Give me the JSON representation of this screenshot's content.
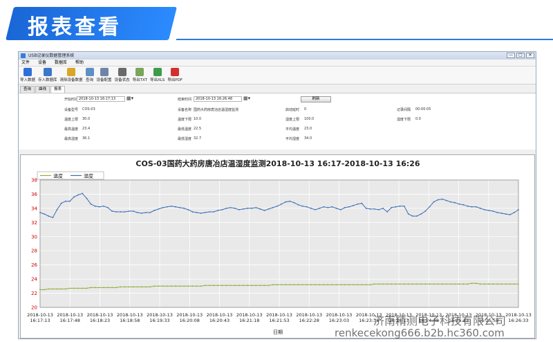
{
  "banner": {
    "title": "报表查看"
  },
  "window": {
    "title": "USB记录仪数据管理系统",
    "controls": [
      "—",
      "□",
      "✕"
    ]
  },
  "menu": [
    "文件",
    "设备",
    "数据库",
    "帮助"
  ],
  "toolbar": [
    {
      "label": "导入数据",
      "icon": "import-icon",
      "color": "#2f6fd8"
    },
    {
      "label": "存入数据库",
      "icon": "database-save-icon",
      "color": "#3a78c9"
    },
    {
      "label": "清除设备数据",
      "icon": "eraser-icon",
      "color": "#d9a62a"
    },
    {
      "label": "查询",
      "icon": "magnifier-icon",
      "color": "#5f8fc7"
    },
    {
      "label": "设备配置",
      "icon": "tools-icon",
      "color": "#6d86a8"
    },
    {
      "label": "设备状态",
      "icon": "device-status-icon",
      "color": "#6a6a6a"
    },
    {
      "label": "导出TXT",
      "icon": "export-txt-icon",
      "color": "#7aa55c"
    },
    {
      "label": "导出XLS",
      "icon": "export-xls-icon",
      "color": "#3f9a4a"
    },
    {
      "label": "导出PDF",
      "icon": "export-pdf-icon",
      "color": "#d32f2f"
    }
  ],
  "tabs": [
    "查询",
    "曲线",
    "报表"
  ],
  "info": {
    "start_label": "开始时间",
    "start_value": "2018-10-13 16:17:13",
    "end_label": "结束时间",
    "end_value": "2018-10-13 16:26:48",
    "refresh_label": "刷新",
    "model_label": "设备型号",
    "model_value": "COS-03",
    "name_label": "设备名称",
    "name_value": "国药大药房唐冶店温湿度监测",
    "startup_label": "启动延时",
    "startup_value": "0",
    "interval_label": "记录间隔",
    "interval_value": "00:00:05",
    "temp_upper_label": "温度上限",
    "temp_upper_value": "30.0",
    "temp_lower_label": "温度下限",
    "temp_lower_value": "10.0",
    "hum_upper_label": "湿度上限",
    "hum_upper_value": "100.0",
    "hum_lower_label": "湿度下限",
    "hum_lower_value": "0.0",
    "temp_max_label": "最高温度",
    "temp_max_value": "23.4",
    "temp_min_label": "最低温度",
    "temp_min_value": "22.5",
    "temp_avg_label": "平均温度",
    "temp_avg_value": "23.0",
    "hum_max_label": "最高湿度",
    "hum_max_value": "36.1",
    "hum_min_label": "最低湿度",
    "hum_min_value": "32.7",
    "hum_avg_label": "平均湿度",
    "hum_avg_value": "34.0"
  },
  "chart_data": {
    "type": "line",
    "title": "COS-03国药大药房唐冶店温湿度监测2018-10-13  16:17-2018-10-13  16:26",
    "xlabel": "日期",
    "ylabel": "",
    "ylim": [
      20,
      38
    ],
    "yticks": [
      20,
      22,
      24,
      26,
      28,
      30,
      32,
      34,
      36,
      38
    ],
    "xticks": [
      "2018-10-13 16:17:13",
      "2018-10-13 16:17:48",
      "2018-10-13 16:18:23",
      "2018-10-13 16:18:58",
      "2018-10-13 16:19:33",
      "2018-10-13 16:20:08",
      "2018-10-13 16:20:43",
      "2018-10-13 16:21:18",
      "2018-10-13 16:21:53",
      "2018-10-13 16:22:28",
      "2018-10-13 16:23:03",
      "2018-10-13 16:23:38",
      "2018-10-13 16:24:13",
      "2018-10-13 16:24:48",
      "2018-10-13 16:25:23",
      "2018-10-13 16:25:58",
      "2018-10-13 16:26:33"
    ],
    "grid": true,
    "legend": "top-left",
    "series": [
      {
        "name": "温度",
        "color": "#8fae3c",
        "values": [
          22.5,
          22.5,
          22.6,
          22.6,
          22.6,
          22.6,
          22.6,
          22.7,
          22.7,
          22.7,
          22.7,
          22.7,
          22.8,
          22.8,
          22.8,
          22.8,
          22.8,
          22.8,
          22.8,
          22.9,
          22.9,
          22.9,
          22.9,
          22.9,
          22.9,
          22.9,
          22.9,
          23.0,
          23.0,
          23.0,
          23.0,
          23.0,
          23.0,
          23.0,
          23.0,
          23.0,
          23.0,
          23.0,
          23.0,
          23.1,
          23.1,
          23.1,
          23.1,
          23.1,
          23.1,
          23.1,
          23.1,
          23.1,
          23.1,
          23.1,
          23.1,
          23.1,
          23.1,
          23.1,
          23.1,
          23.2,
          23.2,
          23.2,
          23.2,
          23.2,
          23.2,
          23.2,
          23.2,
          23.2,
          23.2,
          23.2,
          23.2,
          23.2,
          23.2,
          23.2,
          23.2,
          23.2,
          23.2,
          23.2,
          23.2,
          23.2,
          23.2,
          23.2,
          23.2,
          23.3,
          23.3,
          23.3,
          23.3,
          23.3,
          23.3,
          23.3,
          23.3,
          23.3,
          23.3,
          23.3,
          23.3,
          23.3,
          23.3,
          23.3,
          23.3,
          23.3,
          23.3,
          23.3,
          23.3,
          23.3,
          23.3,
          23.3,
          23.4,
          23.4,
          23.3,
          23.3,
          23.3,
          23.3,
          23.3,
          23.3,
          23.3,
          23.3,
          23.3,
          23.3
        ]
      },
      {
        "name": "湿度",
        "color": "#3a6db5",
        "values": [
          33.4,
          33.2,
          32.9,
          32.7,
          33.8,
          34.7,
          35.0,
          35.0,
          35.6,
          35.9,
          36.1,
          35.4,
          34.6,
          34.3,
          34.2,
          34.3,
          34.1,
          33.6,
          33.5,
          33.5,
          33.5,
          33.6,
          33.6,
          33.4,
          33.3,
          33.4,
          33.4,
          33.7,
          33.9,
          34.1,
          34.2,
          34.3,
          34.2,
          34.1,
          34.0,
          33.8,
          33.5,
          33.4,
          33.3,
          33.4,
          33.5,
          33.5,
          33.7,
          33.8,
          34.0,
          34.1,
          34.0,
          33.8,
          33.9,
          34.0,
          34.0,
          34.1,
          33.9,
          33.7,
          33.9,
          34.1,
          34.3,
          34.6,
          34.9,
          35.0,
          34.8,
          34.5,
          34.3,
          34.2,
          34.0,
          33.8,
          34.0,
          34.2,
          34.1,
          34.2,
          34.0,
          33.8,
          34.1,
          34.2,
          34.4,
          34.6,
          34.7,
          34.0,
          33.9,
          33.9,
          33.8,
          34.0,
          33.5,
          34.1,
          34.2,
          34.3,
          34.3,
          33.2,
          32.9,
          32.9,
          33.2,
          33.6,
          34.2,
          34.9,
          35.2,
          35.3,
          35.1,
          34.9,
          34.8,
          34.6,
          34.5,
          34.3,
          34.2,
          34.2,
          34.0,
          33.8,
          33.7,
          33.6,
          33.4,
          33.3,
          33.2,
          33.1,
          33.4,
          33.8
        ]
      }
    ]
  },
  "watermark": {
    "line1": "济南精测电子科技有限公司",
    "line2": "renkecekong666.b2b.hc360.com"
  }
}
